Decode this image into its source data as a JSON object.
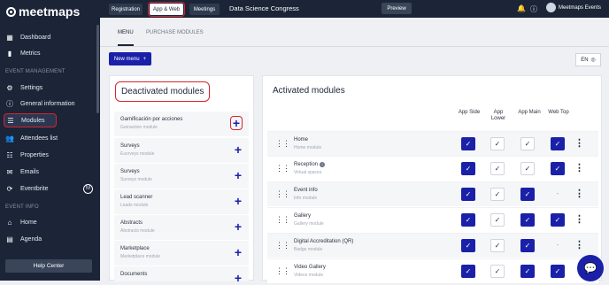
{
  "brand": {
    "name": "meetmaps"
  },
  "sidebar": {
    "items": [
      {
        "label": "Dashboard",
        "icon": "dashboard-icon",
        "glyph": "▦"
      },
      {
        "label": "Metrics",
        "icon": "metrics-icon",
        "glyph": "▮"
      }
    ],
    "section_event": "EVENT MANAGEMENT",
    "event_items": [
      {
        "label": "Settings",
        "icon": "gear-icon",
        "glyph": "⚙"
      },
      {
        "label": "General information",
        "icon": "info-icon",
        "glyph": "ⓘ"
      },
      {
        "label": "Modules",
        "icon": "menu-icon",
        "glyph": "☰"
      },
      {
        "label": "Attendees list",
        "icon": "users-icon",
        "glyph": "👥"
      },
      {
        "label": "Properties",
        "icon": "list-icon",
        "glyph": "☷"
      },
      {
        "label": "Emails",
        "icon": "email-icon",
        "glyph": "✉"
      },
      {
        "label": "Eventbrite",
        "icon": "sync-icon",
        "glyph": "⟳",
        "badge": "M"
      }
    ],
    "section_info": "EVENT INFO",
    "info_items": [
      {
        "label": "Home",
        "icon": "home-icon",
        "glyph": "⌂"
      },
      {
        "label": "Agenda",
        "icon": "calendar-icon",
        "glyph": "▤"
      }
    ],
    "help_label": "Help Center"
  },
  "topbar": {
    "tabs": [
      "Registration",
      "App & Web",
      "Meetings"
    ],
    "event_title": "Data Science Congress",
    "preview_label": "Preview",
    "account_name": "Meetmaps Events"
  },
  "page_tabs": [
    "MENU",
    "PURCHASE MODULES"
  ],
  "new_menu_label": "New menu",
  "language": "EN",
  "deactivated": {
    "title": "Deactivated modules",
    "items": [
      {
        "name": "Gamificación por acciones",
        "sub": "Gamaction module"
      },
      {
        "name": "Surveys",
        "sub": "Eusrveys module"
      },
      {
        "name": "Surveys",
        "sub": "Surveys module"
      },
      {
        "name": "Lead scanner",
        "sub": "Leads module"
      },
      {
        "name": "Abstracts",
        "sub": "Abstracts module"
      },
      {
        "name": "Marketplace",
        "sub": "Marketplace module"
      },
      {
        "name": "Documents",
        "sub": ""
      }
    ]
  },
  "activated": {
    "title": "Activated modules",
    "columns": [
      "App Side",
      "App Lower",
      "App Main",
      "Web Top"
    ],
    "rows": [
      {
        "name": "Home",
        "sub": "Home module",
        "checks": [
          "on",
          "off",
          "off",
          "on"
        ]
      },
      {
        "name": "Reception",
        "sub": "Virtual spaces",
        "info": true,
        "checks": [
          "on",
          "off",
          "off",
          "on"
        ]
      },
      {
        "name": "Event info",
        "sub": "Info module",
        "checks": [
          "on",
          "off",
          "on",
          "dash"
        ]
      },
      {
        "name": "Gallery",
        "sub": "Gallery module",
        "checks": [
          "on",
          "off",
          "on",
          "on"
        ]
      },
      {
        "name": "Digital Accreditation (QR)",
        "sub": "Badge module",
        "checks": [
          "on",
          "off",
          "on",
          "dash"
        ]
      },
      {
        "name": "Video Gallery",
        "sub": "Videos module",
        "checks": [
          "on",
          "off",
          "on",
          "on"
        ]
      }
    ]
  },
  "colors": {
    "primary": "#1a21a8",
    "sidebar_bg": "#1b2537",
    "highlight": "#d9222f"
  }
}
